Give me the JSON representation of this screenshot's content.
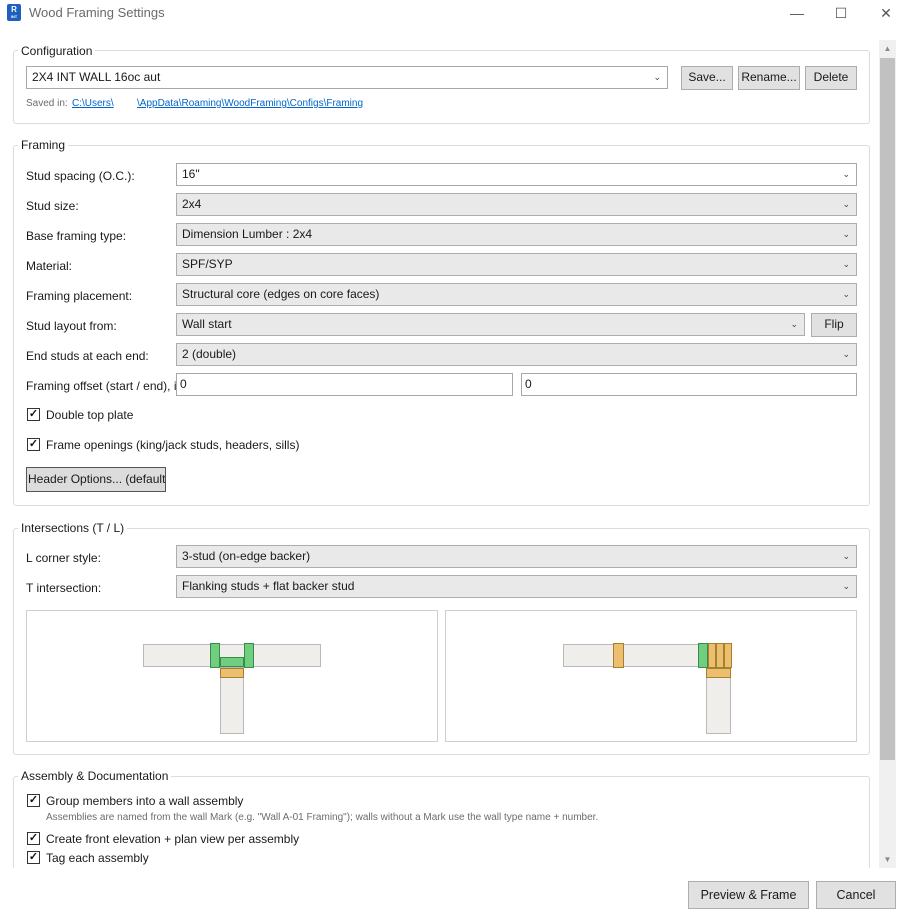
{
  "window": {
    "title": "Wood Framing Settings",
    "app_icon_letter": "R",
    "app_icon_sub": "INT",
    "minimize_glyph": "—",
    "maximize_glyph": "☐",
    "close_glyph": "✕"
  },
  "configuration": {
    "group_title": "Configuration",
    "selected": "2X4 INT WALL 16oc aut",
    "save_label": "Save...",
    "rename_label": "Rename...",
    "delete_label": "Delete",
    "saved_in_label": "Saved in:",
    "path_part1": "C:\\Users\\",
    "path_part2": "\\AppData\\Roaming\\WoodFraming\\Configs\\Framing"
  },
  "framing": {
    "group_title": "Framing",
    "stud_spacing_label": "Stud spacing (O.C.):",
    "stud_spacing_value": "16\"",
    "stud_size_label": "Stud size:",
    "stud_size_value": "2x4",
    "base_type_label": "Base framing type:",
    "base_type_value": "Dimension Lumber : 2x4",
    "material_label": "Material:",
    "material_value": "SPF/SYP",
    "placement_label": "Framing placement:",
    "placement_value": "Structural core (edges on core faces)",
    "layout_from_label": "Stud layout from:",
    "layout_from_value": "Wall start",
    "flip_label": "Flip",
    "end_studs_label": "End studs at each end:",
    "end_studs_value": "2 (double)",
    "offset_label": "Framing offset (start / end), i",
    "offset_start": "0",
    "offset_end": "0",
    "double_top_plate_label": "Double top plate",
    "frame_openings_label": "Frame openings (king/jack studs, headers, sills)",
    "header_options_label": "Header Options... (default"
  },
  "intersections": {
    "group_title": "Intersections (T / L)",
    "l_corner_label": "L corner style:",
    "l_corner_value": "3-stud (on-edge backer)",
    "t_label": "T intersection:",
    "t_value": "Flanking studs + flat backer stud"
  },
  "assembly": {
    "group_title": "Assembly & Documentation",
    "group_members_label": "Group members into a wall assembly",
    "naming_note": "Assemblies are named from the wall Mark (e.g. \"Wall A-01 Framing\"); walls without a Mark use the wall type name + number.",
    "create_views_label": "Create front elevation + plan view per assembly",
    "tag_label": "Tag each assembly"
  },
  "footer": {
    "preview_label": "Preview & Frame",
    "cancel_label": "Cancel"
  },
  "colors": {
    "stud_green": "#6fcf7f",
    "stud_orange": "#ebbf6f",
    "wall_fill": "#efeeea"
  },
  "icons": {
    "dropdown": "chevron-down-icon",
    "check": "checkmark-icon"
  }
}
